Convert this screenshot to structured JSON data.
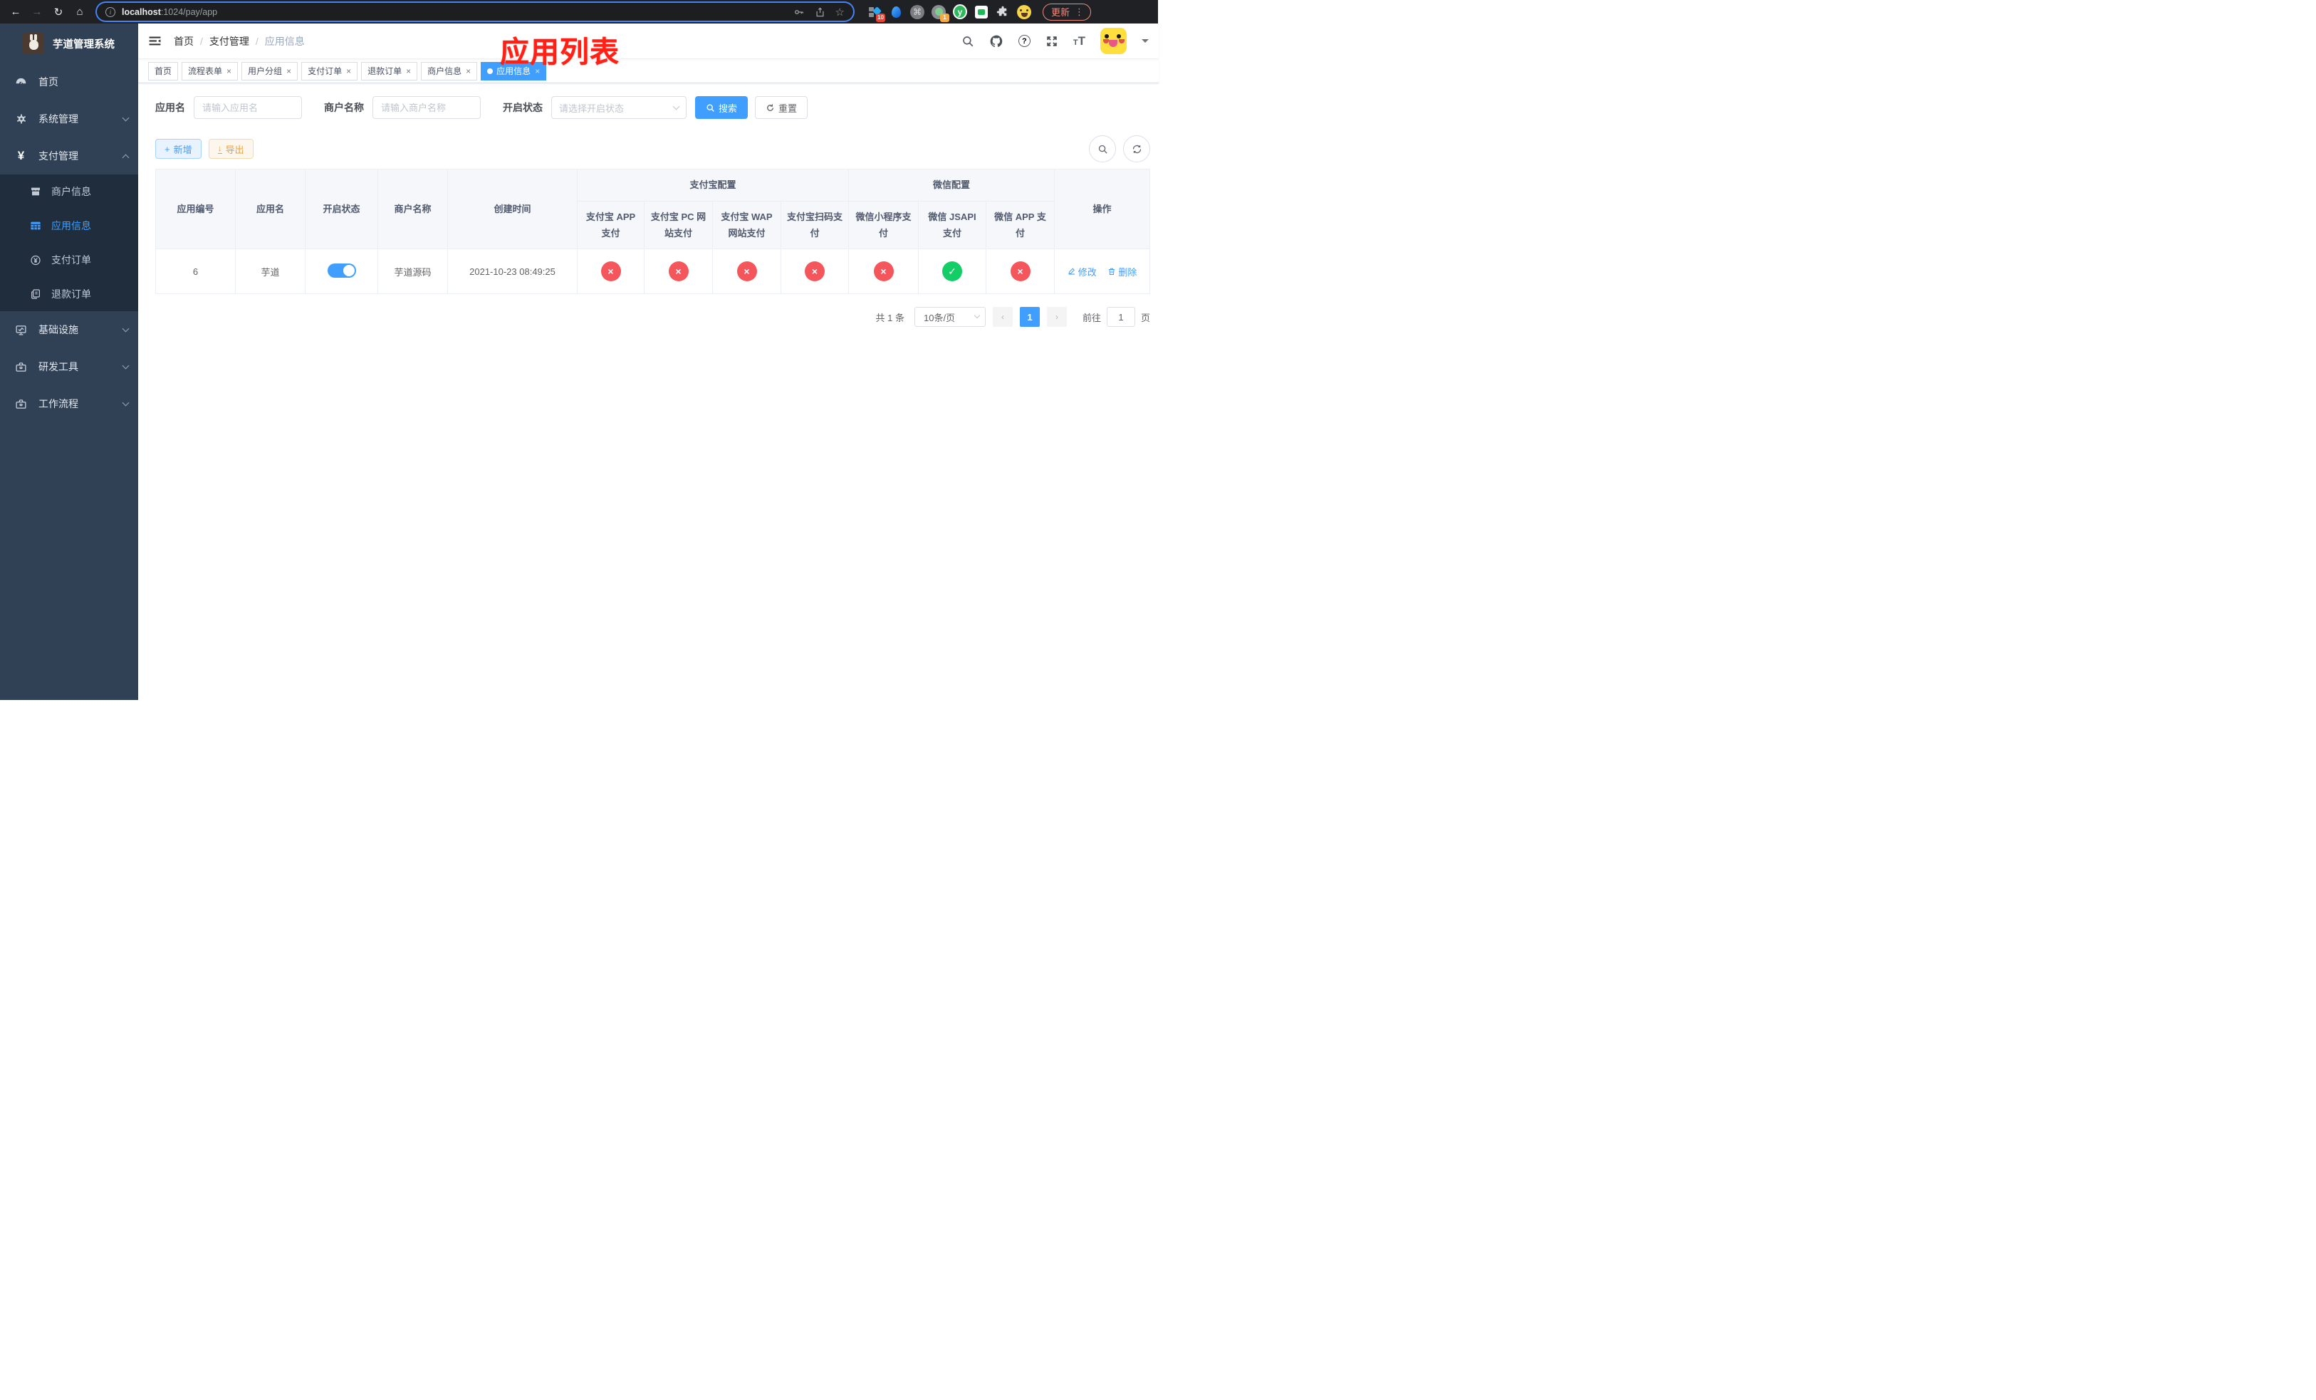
{
  "browser": {
    "url": {
      "host": "localhost",
      "path": ":1024/pay/app"
    },
    "update_button": "更新",
    "kebab_glyph": "⋮",
    "extensions": {
      "blue_badge": "10",
      "green_badge": "1",
      "command_glyph": "⌘",
      "y_glyph": "y"
    }
  },
  "sidebar": {
    "title": "芋道管理系统",
    "menu": [
      {
        "label": "首页",
        "icon": "dashboard-icon"
      },
      {
        "label": "系统管理",
        "icon": "gear-icon",
        "chevron": "down"
      },
      {
        "label": "支付管理",
        "icon": "yen-icon",
        "chevron": "up"
      },
      {
        "label": "商户信息",
        "icon": "store-icon"
      },
      {
        "label": "应用信息",
        "icon": "grid-icon",
        "active": true
      },
      {
        "label": "支付订单",
        "icon": "pay-order-icon"
      },
      {
        "label": "退款订单",
        "icon": "refund-icon"
      },
      {
        "label": "基础设施",
        "icon": "monitor-icon",
        "chevron": "down"
      },
      {
        "label": "研发工具",
        "icon": "toolbox-icon",
        "chevron": "down"
      },
      {
        "label": "工作流程",
        "icon": "toolbox-icon",
        "chevron": "down"
      }
    ]
  },
  "navbar": {
    "breadcrumb": {
      "home": "首页",
      "sep": "/",
      "section": "支付管理",
      "current": "应用信息"
    }
  },
  "annotation": {
    "title": "应用列表",
    "color": "#ff2115"
  },
  "tabs": [
    {
      "label": "首页",
      "closable": false,
      "active": false
    },
    {
      "label": "流程表单",
      "closable": true,
      "active": false
    },
    {
      "label": "用户分组",
      "closable": true,
      "active": false
    },
    {
      "label": "支付订单",
      "closable": true,
      "active": false
    },
    {
      "label": "退款订单",
      "closable": true,
      "active": false
    },
    {
      "label": "商户信息",
      "closable": true,
      "active": false
    },
    {
      "label": "应用信息",
      "closable": true,
      "active": true
    }
  ],
  "filters": {
    "app_name": {
      "label": "应用名",
      "placeholder": "请输入应用名",
      "value": ""
    },
    "merchant_name": {
      "label": "商户名称",
      "placeholder": "请输入商户名称",
      "value": ""
    },
    "status": {
      "label": "开启状态",
      "placeholder": "请选择开启状态"
    },
    "search_label": "搜索",
    "reset_label": "重置"
  },
  "toolbar": {
    "add_label": "新增",
    "export_label": "导出"
  },
  "table": {
    "columns": {
      "app_id": "应用编号",
      "app_name": "应用名",
      "status": "开启状态",
      "merchant": "商户名称",
      "created": "创建时间",
      "alipay_group": "支付宝配置",
      "alipay": [
        "支付宝 APP 支付",
        "支付宝 PC 网站支付",
        "支付宝 WAP 网站支付",
        "支付宝扫码支付"
      ],
      "wechat_group": "微信配置",
      "wechat": [
        "微信小程序支付",
        "微信 JSAPI 支付",
        "微信 APP 支付"
      ],
      "actions": "操作"
    },
    "rows": [
      {
        "app_id": "6",
        "app_name": "芋道",
        "enabled": true,
        "merchant": "芋道源码",
        "created": "2021-10-23 08:49:25",
        "channels": [
          false,
          false,
          false,
          false,
          false,
          true,
          false
        ],
        "edit_label": "修改",
        "delete_label": "删除"
      }
    ]
  },
  "pagination": {
    "total": "共 1 条",
    "page_size": "10条/页",
    "current_page": "1",
    "goto_prefix": "前往",
    "goto_value": "1",
    "goto_suffix": "页"
  },
  "icons": {
    "close": "×",
    "check": "✓",
    "cross": "×",
    "plus": "+",
    "download": "↓",
    "prev": "‹",
    "next": "›",
    "back": "←",
    "forward": "→",
    "reload": "↻",
    "home": "⌂",
    "star": "☆",
    "info": "i",
    "question": "?"
  },
  "colors": {
    "primary": "#409eff",
    "success": "#13ce66",
    "danger": "#f5565c",
    "sidebar": "#304156",
    "submenu": "#1f2d3d"
  }
}
